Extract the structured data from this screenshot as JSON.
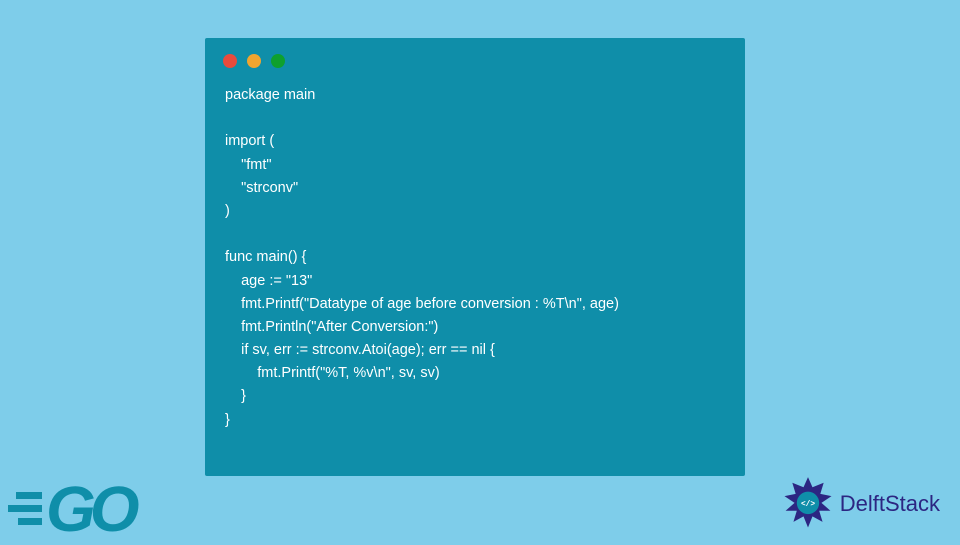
{
  "code": {
    "lines": [
      "package main",
      "",
      "import (",
      "    \"fmt\"",
      "    \"strconv\"",
      ")",
      "",
      "func main() {",
      "    age := \"13\"",
      "    fmt.Printf(\"Datatype of age before conversion : %T\\n\", age)",
      "    fmt.Println(\"After Conversion:\")",
      "    if sv, err := strconv.Atoi(age); err == nil {",
      "        fmt.Printf(\"%T, %v\\n\", sv, sv)",
      "    }",
      "}"
    ]
  },
  "go_logo_text": "GO",
  "delftstack_text": "DelftStack",
  "delftstack_symbol": "</>"
}
